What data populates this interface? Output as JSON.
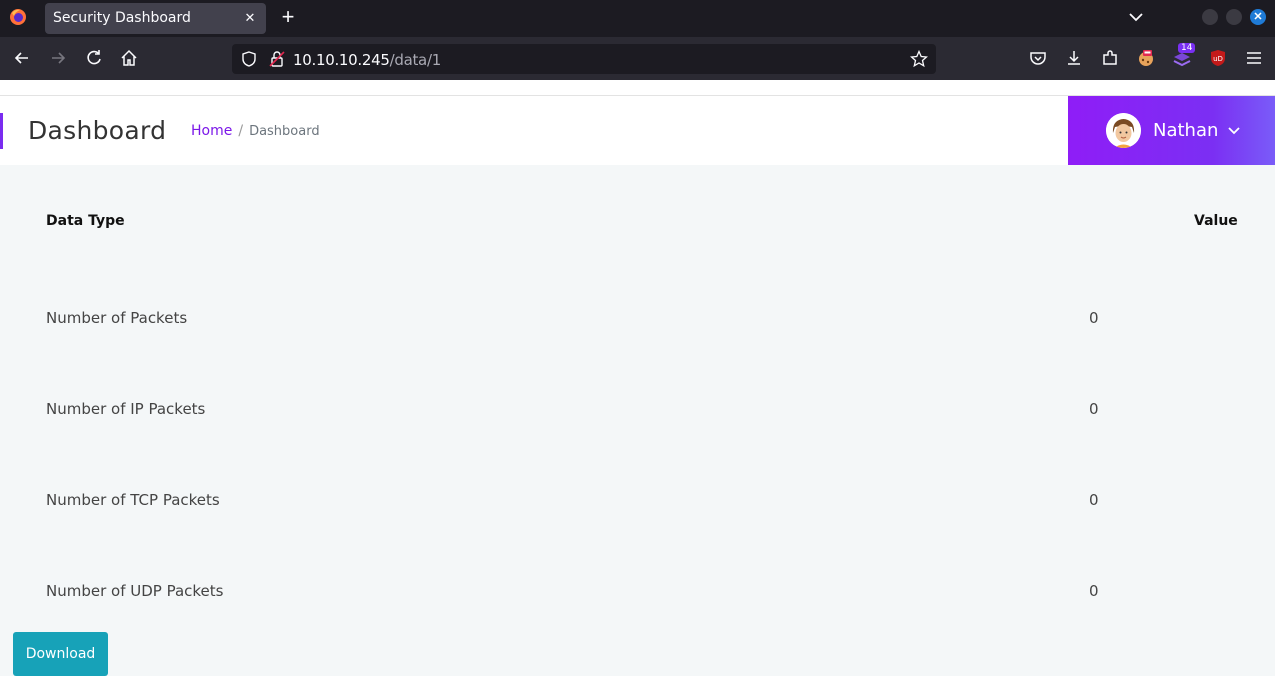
{
  "browser": {
    "tab_title": "Security Dashboard",
    "tab_close": "✕",
    "url_host": "10.10.10.245",
    "url_path": "/data/1",
    "extension_badge": "14"
  },
  "header": {
    "title": "Dashboard",
    "breadcrumb_home": "Home",
    "breadcrumb_separator": "/",
    "breadcrumb_current": "Dashboard",
    "user_name": "Nathan"
  },
  "table": {
    "col_type": "Data Type",
    "col_value": "Value",
    "rows": [
      {
        "label": "Number of Packets",
        "value": "0"
      },
      {
        "label": "Number of IP Packets",
        "value": "0"
      },
      {
        "label": "Number of TCP Packets",
        "value": "0"
      },
      {
        "label": "Number of UDP Packets",
        "value": "0"
      }
    ]
  },
  "actions": {
    "download_label": "Download"
  },
  "colors": {
    "accent": "#7b17e8",
    "user_box": "#8f1df7",
    "download": "#17a2b8"
  }
}
